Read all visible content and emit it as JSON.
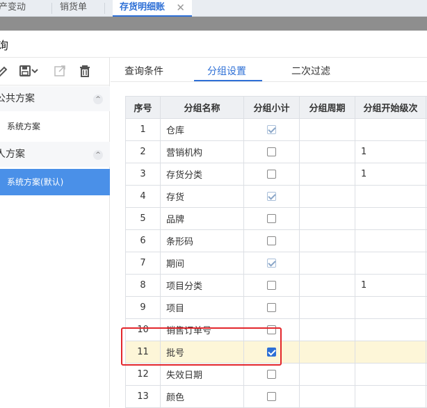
{
  "tabs": {
    "tab1": "产变动",
    "tab2": "销货单",
    "active": "存货明细账",
    "close": "✕"
  },
  "dialog": {
    "title": "询"
  },
  "left": {
    "public_scheme": "公共方案",
    "public_items": [
      "系统方案"
    ],
    "personal_scheme": "人方案",
    "personal_items": [
      "系统方案(默认)"
    ],
    "chevron": "^"
  },
  "right_tabs": {
    "query": "查询条件",
    "group": "分组设置",
    "filter": "二次过滤"
  },
  "grid": {
    "headers": [
      "序号",
      "分组名称",
      "分组小计",
      "分组周期",
      "分组开始级次"
    ],
    "rows": [
      {
        "no": "1",
        "name": "仓库",
        "subtotal": "on",
        "period": "",
        "level": ""
      },
      {
        "no": "2",
        "name": "营销机构",
        "subtotal": "off",
        "period": "",
        "level": "1"
      },
      {
        "no": "3",
        "name": "存货分类",
        "subtotal": "off",
        "period": "",
        "level": "1"
      },
      {
        "no": "4",
        "name": "存货",
        "subtotal": "on",
        "period": "",
        "level": ""
      },
      {
        "no": "5",
        "name": "品牌",
        "subtotal": "off",
        "period": "",
        "level": ""
      },
      {
        "no": "6",
        "name": "条形码",
        "subtotal": "off",
        "period": "",
        "level": ""
      },
      {
        "no": "7",
        "name": "期间",
        "subtotal": "on",
        "period": "",
        "level": ""
      },
      {
        "no": "8",
        "name": "项目分类",
        "subtotal": "off",
        "period": "",
        "level": "1"
      },
      {
        "no": "9",
        "name": "项目",
        "subtotal": "off",
        "period": "",
        "level": ""
      },
      {
        "no": "10",
        "name": "销售订单号",
        "subtotal": "off",
        "period": "",
        "level": ""
      },
      {
        "no": "11",
        "name": "批号",
        "subtotal": "active",
        "period": "",
        "level": "",
        "highlight": true
      },
      {
        "no": "12",
        "name": "失效日期",
        "subtotal": "off",
        "period": "",
        "level": ""
      },
      {
        "no": "13",
        "name": "颜色",
        "subtotal": "off",
        "period": "",
        "level": ""
      }
    ]
  },
  "colors": {
    "accent": "#2d6fd6",
    "selected_bg": "#4a90e8",
    "highlight_row": "#fdf6d8",
    "annotation": "#e3262b"
  }
}
